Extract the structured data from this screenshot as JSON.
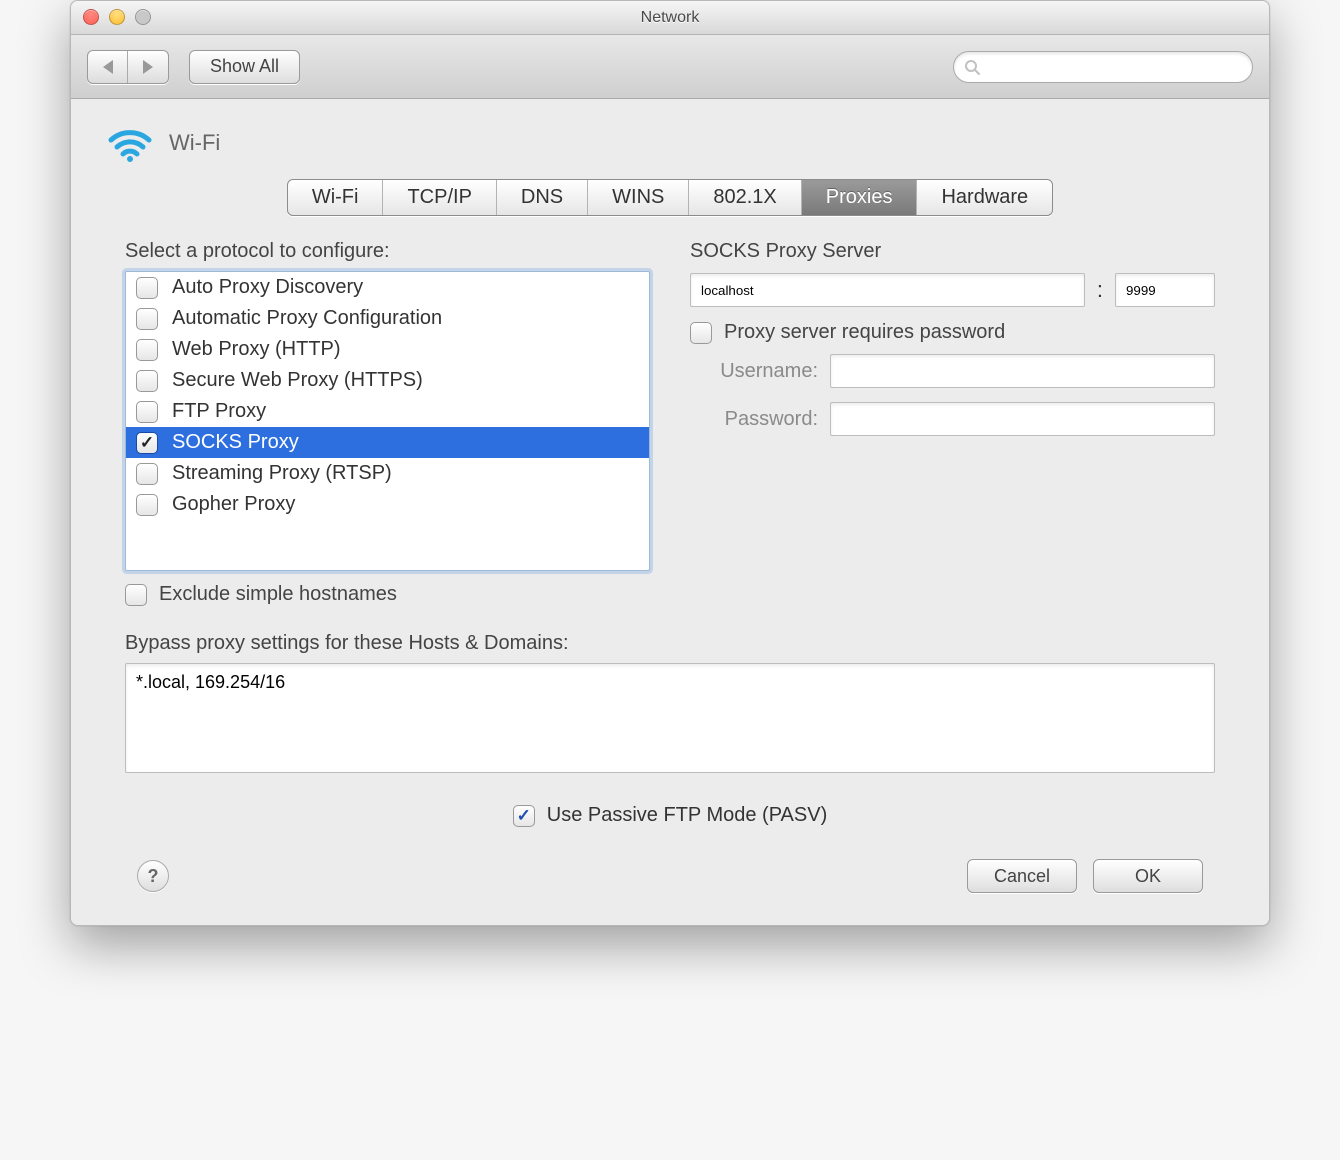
{
  "window": {
    "title": "Network"
  },
  "toolbar": {
    "show_all": "Show All"
  },
  "header": {
    "interface": "Wi-Fi"
  },
  "tabs": [
    "Wi-Fi",
    "TCP/IP",
    "DNS",
    "WINS",
    "802.1X",
    "Proxies",
    "Hardware"
  ],
  "active_tab_index": 5,
  "protocols": {
    "label": "Select a protocol to configure:",
    "items": [
      {
        "label": "Auto Proxy Discovery",
        "checked": false,
        "selected": false
      },
      {
        "label": "Automatic Proxy Configuration",
        "checked": false,
        "selected": false
      },
      {
        "label": "Web Proxy (HTTP)",
        "checked": false,
        "selected": false
      },
      {
        "label": "Secure Web Proxy (HTTPS)",
        "checked": false,
        "selected": false
      },
      {
        "label": "FTP Proxy",
        "checked": false,
        "selected": false
      },
      {
        "label": "SOCKS Proxy",
        "checked": true,
        "selected": true
      },
      {
        "label": "Streaming Proxy (RTSP)",
        "checked": false,
        "selected": false
      },
      {
        "label": "Gopher Proxy",
        "checked": false,
        "selected": false
      }
    ],
    "exclude_simple_label": "Exclude simple hostnames",
    "exclude_simple_checked": false
  },
  "proxy": {
    "title": "SOCKS Proxy Server",
    "host": "localhost",
    "port": "9999",
    "requires_password_label": "Proxy server requires password",
    "requires_password_checked": false,
    "username_label": "Username:",
    "password_label": "Password:",
    "username": "",
    "password": ""
  },
  "bypass": {
    "label": "Bypass proxy settings for these Hosts & Domains:",
    "value": "*.local, 169.254/16"
  },
  "pasv": {
    "label": "Use Passive FTP Mode (PASV)",
    "checked": true
  },
  "footer": {
    "cancel": "Cancel",
    "ok": "OK"
  }
}
